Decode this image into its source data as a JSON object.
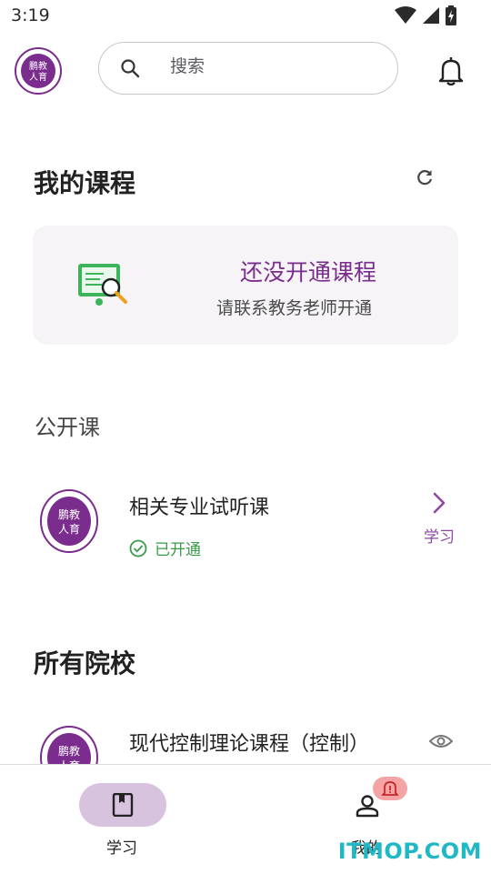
{
  "status_bar": {
    "time": "3:19"
  },
  "search": {
    "placeholder": "搜索"
  },
  "my_courses": {
    "title": "我的课程",
    "empty_title": "还没开通课程",
    "empty_subtitle": "请联系教务老师开通"
  },
  "public_courses": {
    "heading": "公开课",
    "items": [
      {
        "title": "相关专业试听课",
        "status": "已开通",
        "action": "学习"
      }
    ]
  },
  "all_schools": {
    "title": "所有院校",
    "items": [
      {
        "title": "现代控制理论课程（控制）"
      }
    ]
  },
  "bottom_nav": {
    "items": [
      {
        "label": "学习"
      },
      {
        "label": "我的"
      }
    ]
  },
  "watermark": "ITMOP.COM",
  "colors": {
    "accent": "#7b2d8e",
    "success": "#3a9a4a",
    "nav_active": "#d8c3df"
  }
}
